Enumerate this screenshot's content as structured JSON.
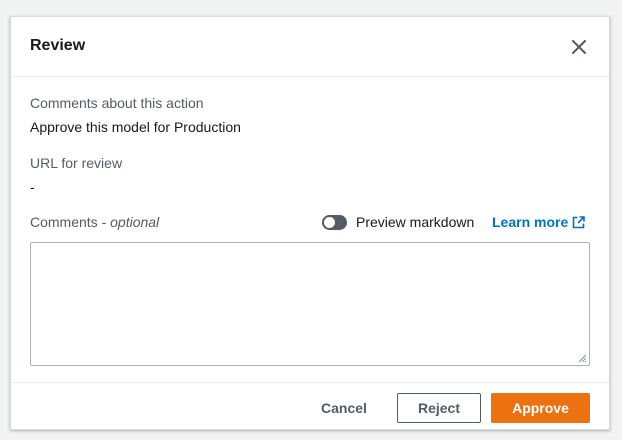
{
  "modal": {
    "title": "Review",
    "close_icon": "close-icon"
  },
  "fields": {
    "comments_action_label": "Comments about this action",
    "comments_action_value": "Approve this model for Production",
    "url_label": "URL for review",
    "url_value": "-",
    "comments_label": "Comments - ",
    "comments_optional": "optional",
    "comments_value": "",
    "comments_placeholder": ""
  },
  "markdown": {
    "toggle_label": "Preview markdown",
    "toggle_on": false,
    "learn_more": "Learn more",
    "external_icon": "external-link-icon"
  },
  "footer": {
    "cancel_label": "Cancel",
    "reject_label": "Reject",
    "approve_label": "Approve"
  },
  "colors": {
    "accent": "#ec7211",
    "link": "#0073bb",
    "toggle_off": "#545b64"
  }
}
